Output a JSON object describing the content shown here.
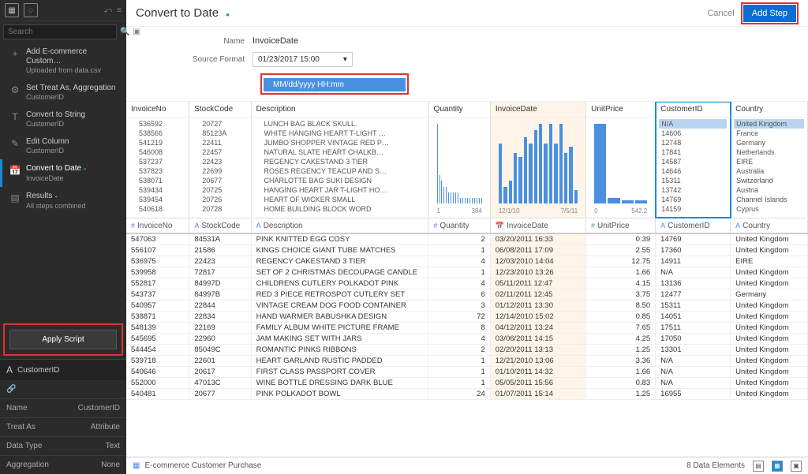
{
  "sidebar": {
    "search_placeholder": "Search",
    "items": [
      {
        "icon": "+",
        "main": "Add E-commerce Custom…",
        "sub": "Uploaded from data.csv"
      },
      {
        "icon": "⚙",
        "main": "Set Treat As, Aggregation",
        "sub": "CustomerID"
      },
      {
        "icon": "T",
        "main": "Convert to String",
        "sub": "CustomerID"
      },
      {
        "icon": "✎",
        "main": "Edit Column",
        "sub": "CustomerID"
      },
      {
        "icon": "📅",
        "main": "Convert to Date",
        "sub": "InvoiceDate",
        "active": true,
        "dot": true
      },
      {
        "icon": "▤",
        "main": "Results",
        "sub": "All steps combined",
        "dot": true
      }
    ],
    "apply_script": "Apply Script",
    "props_title": "CustomerID",
    "props": [
      {
        "k": "Name",
        "v": "CustomerID"
      },
      {
        "k": "Treat As",
        "v": "Attribute"
      },
      {
        "k": "Data Type",
        "v": "Text"
      },
      {
        "k": "Aggregation",
        "v": "None"
      }
    ]
  },
  "header": {
    "title": "Convert to Date",
    "cancel": "Cancel",
    "add_step": "Add Step"
  },
  "form": {
    "name_label": "Name",
    "name_value": "InvoiceDate",
    "fmt_label": "Source Format",
    "fmt_value": "01/23/2017 15:00",
    "pattern": "MM/dd/yyyy HH:mm"
  },
  "columns": [
    "InvoiceNo",
    "StockCode",
    "Description",
    "Quantity",
    "InvoiceDate",
    "UnitPrice",
    "CustomerID",
    "Country"
  ],
  "summary": {
    "invoiceNo": [
      "536592",
      "538566",
      "541219",
      "546008",
      "537237",
      "537823",
      "538071",
      "539434",
      "539454",
      "540618"
    ],
    "stockCode": [
      "20727",
      "85123A",
      "22411",
      "22457",
      "22423",
      "22699",
      "20677",
      "20725",
      "20726",
      "20728"
    ],
    "description": [
      "LUNCH BAG BLACK SKULL.",
      "WHITE HANGING HEART T-LIGHT …",
      "JUMBO SHOPPER VINTAGE RED P…",
      "NATURAL SLATE HEART CHALKB…",
      "REGENCY CAKESTAND 3 TIER",
      "ROSES REGENCY TEACUP AND S…",
      "CHARLOTTE BAG SUKI DESIGN",
      "HANGING HEART JAR T-LIGHT HO…",
      "HEART OF WICKER SMALL",
      "HOME BUILDING BLOCK WORD"
    ],
    "qty_axis": [
      "1",
      "384"
    ],
    "date_axis": [
      "12/1/10",
      "7/5/11"
    ],
    "up_axis": [
      "0",
      "542.2"
    ],
    "customerId": [
      "N/A",
      "14606",
      "12748",
      "17841",
      "14587",
      "14646",
      "15311",
      "13742",
      "14769",
      "14159"
    ],
    "country": [
      "United Kingdom",
      "France",
      "Germany",
      "Netherlands",
      "EIRE",
      "Australia",
      "Switzerland",
      "Austria",
      "Channel Islands",
      "Cyprus"
    ]
  },
  "rows": [
    {
      "inv": "547063",
      "sc": "84531A",
      "desc": "PINK KNITTED EGG COSY",
      "qty": "2",
      "date": "03/20/2011 16:33",
      "up": "0.39",
      "cust": "14769",
      "country": "United Kingdom"
    },
    {
      "inv": "556107",
      "sc": "21586",
      "desc": "KINGS CHOICE GIANT TUBE MATCHES",
      "qty": "1",
      "date": "06/08/2011 17:09",
      "up": "2.55",
      "cust": "17360",
      "country": "United Kingdom"
    },
    {
      "inv": "536975",
      "sc": "22423",
      "desc": "REGENCY CAKESTAND 3 TIER",
      "qty": "4",
      "date": "12/03/2010 14:04",
      "up": "12.75",
      "cust": "14911",
      "country": "EIRE"
    },
    {
      "inv": "539958",
      "sc": "72817",
      "desc": "SET OF 2 CHRISTMAS DECOUPAGE CANDLE",
      "qty": "1",
      "date": "12/23/2010 13:26",
      "up": "1.66",
      "cust": "N/A",
      "country": "United Kingdom"
    },
    {
      "inv": "552817",
      "sc": "84997D",
      "desc": "CHILDRENS CUTLERY POLKADOT PINK",
      "qty": "4",
      "date": "05/11/2011 12:47",
      "up": "4.15",
      "cust": "13136",
      "country": "United Kingdom"
    },
    {
      "inv": "543737",
      "sc": "84997B",
      "desc": "RED 3 PIECE RETROSPOT CUTLERY SET",
      "qty": "6",
      "date": "02/11/2011 12:45",
      "up": "3.75",
      "cust": "12477",
      "country": "Germany"
    },
    {
      "inv": "540957",
      "sc": "22844",
      "desc": "VINTAGE CREAM DOG FOOD CONTAINER",
      "qty": "3",
      "date": "01/12/2011 13:30",
      "up": "8.50",
      "cust": "15311",
      "country": "United Kingdom"
    },
    {
      "inv": "538871",
      "sc": "22834",
      "desc": "HAND WARMER BABUSHKA DESIGN",
      "qty": "72",
      "date": "12/14/2010 15:02",
      "up": "0.85",
      "cust": "14051",
      "country": "United Kingdom"
    },
    {
      "inv": "548139",
      "sc": "22169",
      "desc": "FAMILY ALBUM WHITE PICTURE FRAME",
      "qty": "8",
      "date": "04/12/2011 13:24",
      "up": "7.65",
      "cust": "17511",
      "country": "United Kingdom"
    },
    {
      "inv": "545695",
      "sc": "22960",
      "desc": "JAM MAKING SET WITH JARS",
      "qty": "4",
      "date": "03/06/2011 14:15",
      "up": "4.25",
      "cust": "17050",
      "country": "United Kingdom"
    },
    {
      "inv": "544454",
      "sc": "85049C",
      "desc": "ROMANTIC PINKS RIBBONS",
      "qty": "2",
      "date": "02/20/2011 13:13",
      "up": "1.25",
      "cust": "13301",
      "country": "United Kingdom"
    },
    {
      "inv": "539718",
      "sc": "22601",
      "desc": "HEART GARLAND RUSTIC PADDED",
      "qty": "1",
      "date": "12/21/2010 13:06",
      "up": "3.36",
      "cust": "N/A",
      "country": "United Kingdom"
    },
    {
      "inv": "540646",
      "sc": "20617",
      "desc": "FIRST CLASS PASSPORT COVER",
      "qty": "1",
      "date": "01/10/2011 14:32",
      "up": "1.66",
      "cust": "N/A",
      "country": "United Kingdom"
    },
    {
      "inv": "552000",
      "sc": "47013C",
      "desc": "WINE BOTTLE DRESSING DARK BLUE",
      "qty": "1",
      "date": "05/05/2011 15:56",
      "up": "0.83",
      "cust": "N/A",
      "country": "United Kingdom"
    },
    {
      "inv": "540481",
      "sc": "20677",
      "desc": "PINK POLKADOT BOWL",
      "qty": "24",
      "date": "01/07/2011 15:14",
      "up": "1.25",
      "cust": "16955",
      "country": "United Kingdom"
    }
  ],
  "footer": {
    "tab": "E-commerce Customer Purchase",
    "count": "8 Data Elements"
  },
  "chart_data": {
    "type": "bar",
    "charts": [
      {
        "name": "Quantity",
        "xlabel": "",
        "ylabel": "",
        "categories": [],
        "values": [
          14,
          5,
          4,
          3,
          3,
          2,
          2,
          2,
          2,
          2,
          1,
          1,
          1,
          1,
          1,
          1,
          1,
          1,
          1,
          1
        ],
        "xaxis": [
          1,
          384
        ]
      },
      {
        "name": "InvoiceDate",
        "xlabel": "",
        "ylabel": "",
        "categories": [],
        "values": [
          18,
          5,
          7,
          15,
          14,
          20,
          18,
          22,
          24,
          18,
          24,
          18,
          24,
          15,
          17,
          4
        ],
        "xaxis": [
          "12/1/10",
          "7/5/11"
        ]
      },
      {
        "name": "UnitPrice",
        "xlabel": "",
        "ylabel": "",
        "categories": [],
        "values": [
          28,
          2,
          1,
          1
        ],
        "xaxis": [
          0,
          542.2
        ]
      }
    ]
  }
}
